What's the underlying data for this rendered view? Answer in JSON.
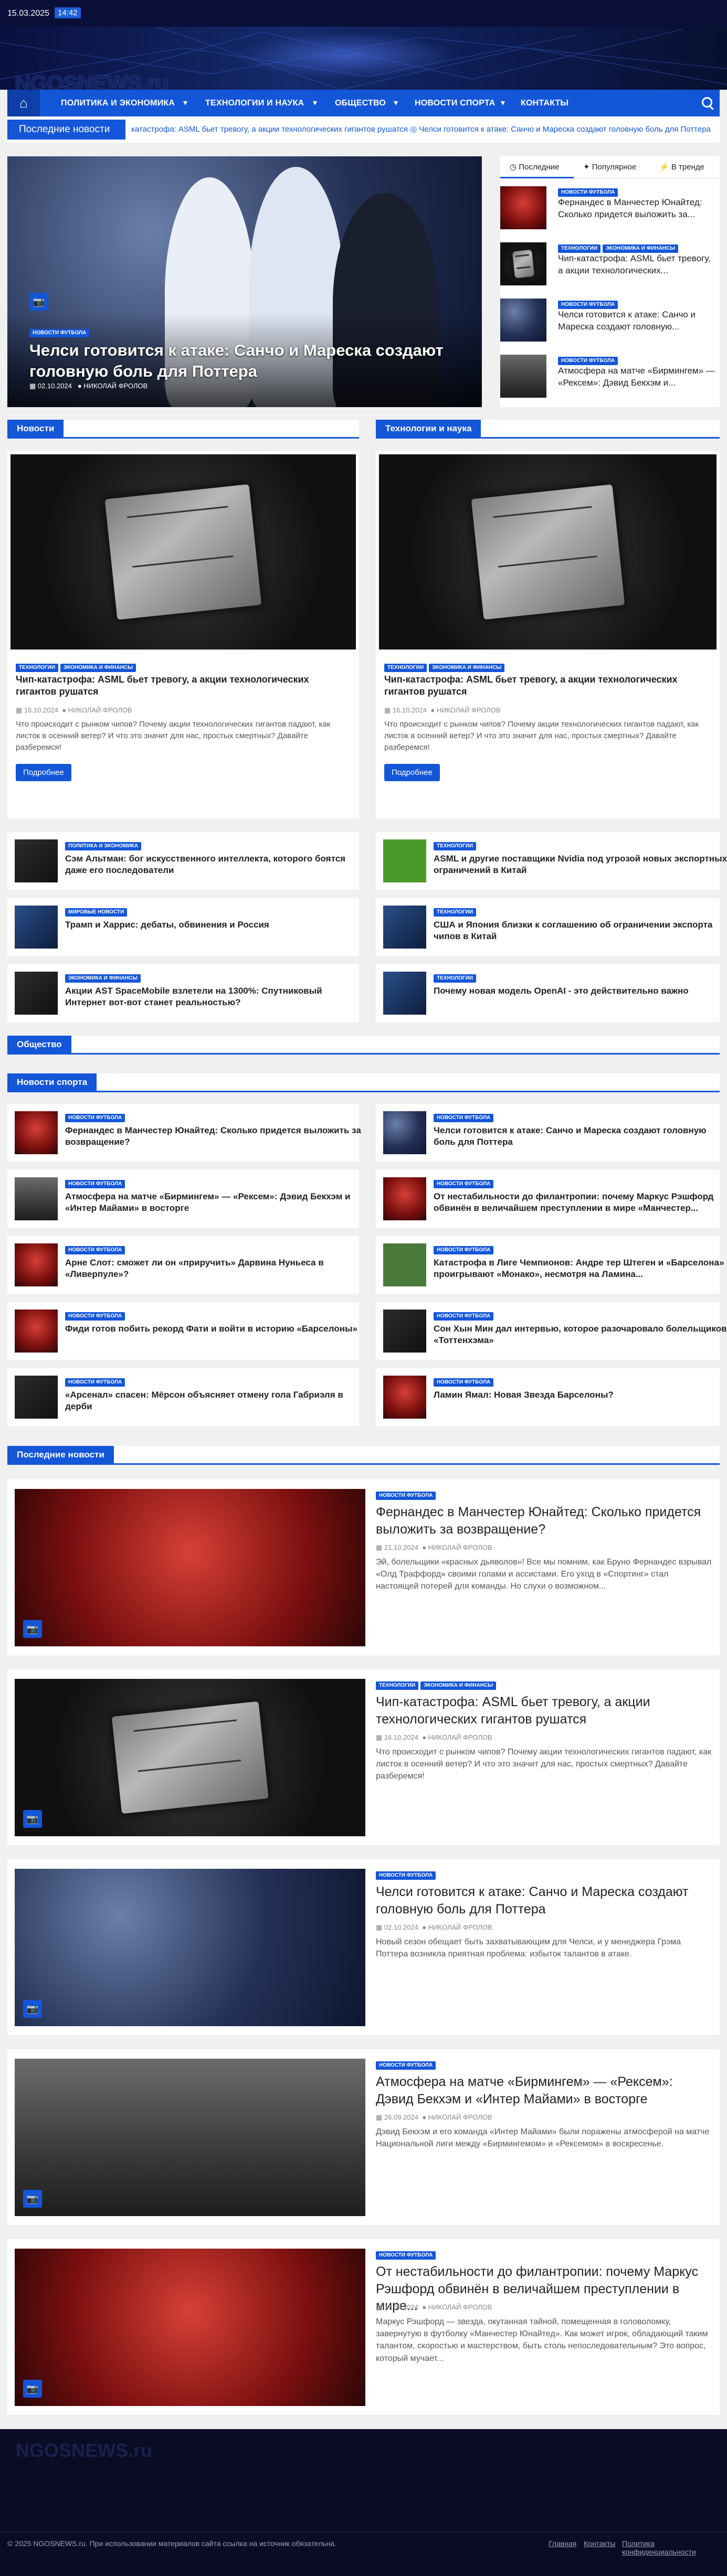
{
  "topbar": {
    "date": "15.03.2025",
    "time": "14:42"
  },
  "brand": {
    "logo": "NGOSNEWS.ru",
    "accent": "#1456d8"
  },
  "nav": {
    "items": [
      "ПОЛИТИКА И ЭКОНОМИКА",
      "ТЕХНОЛОГИИ И НАУКА",
      "ОБЩЕСТВО",
      "НОВОСТИ СПОРТА",
      "КОНТАКТЫ"
    ]
  },
  "ticker": {
    "label": "Последние новости",
    "text": "катастрофа: ASML бьет тревогу, а акции технологических гигантов рушатся   ◎ Челси готовится к атаке: Санчо и Мареска создают головную боль для Поттера"
  },
  "hero": {
    "badge": "НОВОСТИ ФУТБОЛА",
    "title": "Челси готовится к атаке: Санчо и Мареска создают головную боль для Поттера",
    "date": "02.10.2024",
    "author": "НИКОЛАЙ ФРОЛОВ"
  },
  "tabs": {
    "labels": [
      "Последние",
      "Популярное",
      "В тренде"
    ],
    "items": [
      {
        "badges": [
          "НОВОСТИ ФУТБОЛА"
        ],
        "title": "Фернандес в Манчестер Юнайтед: Сколько придется выложить за..."
      },
      {
        "badges": [
          "ТЕХНОЛОГИИ",
          "ЭКОНОМИКА И ФИНАНСЫ"
        ],
        "title": "Чип-катастрофа: ASML бьет тревогу, а акции технологических..."
      },
      {
        "badges": [
          "НОВОСТИ ФУТБОЛА"
        ],
        "title": "Челси готовится к атаке: Санчо и Мареска создают головную..."
      },
      {
        "badges": [
          "НОВОСТИ ФУТБОЛА"
        ],
        "title": "Атмосфера на матче «Бирмингем» — «Рексем»: Дэвид Бекхэм и..."
      }
    ]
  },
  "sections": {
    "news": "Новости",
    "tech": "Технологии и наука",
    "society": "Общество",
    "sport": "Новости спорта",
    "latest": "Последние новости"
  },
  "cards": [
    {
      "badges": [
        "ТЕХНОЛОГИИ",
        "ЭКОНОМИКА И ФИНАНСЫ"
      ],
      "title": "Чип-катастрофа: ASML бьет тревогу, а акции технологических гигантов рушатся",
      "date": "16.10.2024",
      "author": "НИКОЛАЙ ФРОЛОВ",
      "excerpt": "Что происходит с рынком чипов? Почему акции технологических гигантов падают, как листок в осенний ветер? И что это значит для нас, простых смертных? Давайте разберемся!",
      "more": "Подробнее"
    },
    {
      "badges": [
        "ТЕХНОЛОГИИ",
        "ЭКОНОМИКА И ФИНАНСЫ"
      ],
      "title": "Чип-катастрофа: ASML бьет тревогу, а акции технологических гигантов рушатся",
      "date": "16.10.2024",
      "author": "НИКОЛАЙ ФРОЛОВ",
      "excerpt": "Что происходит с рынком чипов? Почему акции технологических гигантов падают, как листок в осенний ветер? И что это значит для нас, простых смертных? Давайте разберемся!",
      "more": "Подробнее"
    }
  ],
  "mini_left": [
    {
      "badges": [
        "ПОЛИТИКА И ЭКОНОМИКА"
      ],
      "title": "Сэм Альтман: бог искусственного интеллекта, которого боятся даже его последователи"
    },
    {
      "badges": [
        "МИРОВЫЕ НОВОСТИ"
      ],
      "title": "Трамп и Харрис: дебаты, обвинения и Россия"
    },
    {
      "badges": [
        "ЭКОНОМИКА И ФИНАНСЫ"
      ],
      "title": "Акции AST SpaceMobile взлетели на 1300%: Спутниковый Интернет вот-вот станет реальностью?"
    }
  ],
  "mini_right": [
    {
      "badges": [
        "ТЕХНОЛОГИИ"
      ],
      "title": "ASML и другие поставщики Nvidia под угрозой новых экспортных ограничений в Китай"
    },
    {
      "badges": [
        "ТЕХНОЛОГИИ"
      ],
      "title": "США и Япония близки к соглашению об ограничении экспорта чипов в Китай"
    },
    {
      "badges": [
        "ТЕХНОЛОГИИ"
      ],
      "title": "Почему новая модель OpenAI - это действительно важно"
    }
  ],
  "sport_left": [
    {
      "badges": [
        "НОВОСТИ ФУТБОЛА"
      ],
      "title": "Фернандес в Манчестер Юнайтед: Сколько придется выложить за возвращение?"
    },
    {
      "badges": [
        "НОВОСТИ ФУТБОЛА"
      ],
      "title": "Атмосфера на матче «Бирмингем» — «Рексем»: Дэвид Бекхэм и «Интер Майами» в восторге"
    },
    {
      "badges": [
        "НОВОСТИ ФУТБОЛА"
      ],
      "title": "Арне Слот: сможет ли он «приручить» Дарвина Нуньеса в «Ливерпуле»?"
    },
    {
      "badges": [
        "НОВОСТИ ФУТБОЛА"
      ],
      "title": "Фиди готов побить рекорд Фати и войти в историю «Барселоны»"
    },
    {
      "badges": [
        "НОВОСТИ ФУТБОЛА"
      ],
      "title": "«Арсенал» спасен: Мёрсон объясняет отмену гола Габриэля в дерби"
    }
  ],
  "sport_right": [
    {
      "badges": [
        "НОВОСТИ ФУТБОЛА"
      ],
      "title": "Челси готовится к атаке: Санчо и Мареска создают головную боль для Поттера"
    },
    {
      "badges": [
        "НОВОСТИ ФУТБОЛА"
      ],
      "title": "От нестабильности до филантропии: почему Маркус Рэшфорд обвинён в величайшем преступлении в мире «Манчестер..."
    },
    {
      "badges": [
        "НОВОСТИ ФУТБОЛА"
      ],
      "title": "Катастрофа в Лиге Чемпионов: Андре тер Штеген и «Барселона» проигрывают «Монако», несмотря на Ламина..."
    },
    {
      "badges": [
        "НОВОСТИ ФУТБОЛА"
      ],
      "title": "Сон Хын Мин дал интервью, которое разочаровало болельщиков «Тоттенхэма»"
    },
    {
      "badges": [
        "НОВОСТИ ФУТБОЛА"
      ],
      "title": "Ламин Ямал: Новая Звезда Барселоны?"
    }
  ],
  "latest": [
    {
      "badges": [
        "НОВОСТИ ФУТБОЛА"
      ],
      "title": "Фернандес в Манчестер Юнайтед: Сколько придется выложить за возвращение?",
      "date": "21.10.2024",
      "author": "НИКОЛАЙ ФРОЛОВ",
      "excerpt": "Эй, болельщики «красных дьяволов»! Все мы помним, как Бруно Фернандес взрывал «Олд Траффорд» своими голами и ассистами. Его уход в «Спортинг» стал настоящей потерей для команды. Но слухи о возможном..."
    },
    {
      "badges": [
        "ТЕХНОЛОГИИ",
        "ЭКОНОМИКА И ФИНАНСЫ"
      ],
      "title": "Чип-катастрофа: ASML бьет тревогу, а акции технологических гигантов рушатся",
      "date": "16.10.2024",
      "author": "НИКОЛАЙ ФРОЛОВ",
      "excerpt": "Что происходит с рынком чипов? Почему акции технологических гигантов падают, как листок в осенний ветер? И что это значит для нас, простых смертных? Давайте разберемся!"
    },
    {
      "badges": [
        "НОВОСТИ ФУТБОЛА"
      ],
      "title": "Челси готовится к атаке: Санчо и Мареска создают головную боль для Поттера",
      "date": "02.10.2024",
      "author": "НИКОЛАЙ ФРОЛОВ",
      "excerpt": "Новый сезон обещает быть захватывающим для Челси, и у менеджера Грэма Поттера возникла приятная проблема: избыток талантов в атаке."
    },
    {
      "badges": [
        "НОВОСТИ ФУТБОЛА"
      ],
      "title": "Атмосфера на матче «Бирмингем» — «Рексем»: Дэвид Бекхэм и «Интер Майами» в восторге",
      "date": "26.09.2024",
      "author": "НИКОЛАЙ ФРОЛОВ",
      "excerpt": "Дэвид Бекхэм и его команда «Интер Майами» были поражены атмосферой на матче Национальной лиги между «Бирмингемом» и «Рексемом» в воскресенье."
    },
    {
      "badges": [
        "НОВОСТИ ФУТБОЛА"
      ],
      "title": "От нестабильности до филантропии: почему Маркус Рэшфорд обвинён в величайшем преступлении в мире...",
      "date": "17.09.2024",
      "author": "НИКОЛАЙ ФРОЛОВ",
      "excerpt": "Маркус Рэшфорд — звезда, окутанная тайной, помещенная в головоломку, завернутую в футболку «Манчестер Юнайтед». Как может игрок, обладающий таким талантом, скоростью и мастерством, быть столь непоследовательным? Это вопрос, который мучает..."
    }
  ],
  "footer": {
    "logo": "NGOSNEWS.ru",
    "copyright": "© 2025 NGOSNEWS.ru. При использовании материалов сайта ссылка на источник обязательна.",
    "links": [
      "Главная",
      "Контакты",
      "Политика конфиденциальности"
    ]
  }
}
